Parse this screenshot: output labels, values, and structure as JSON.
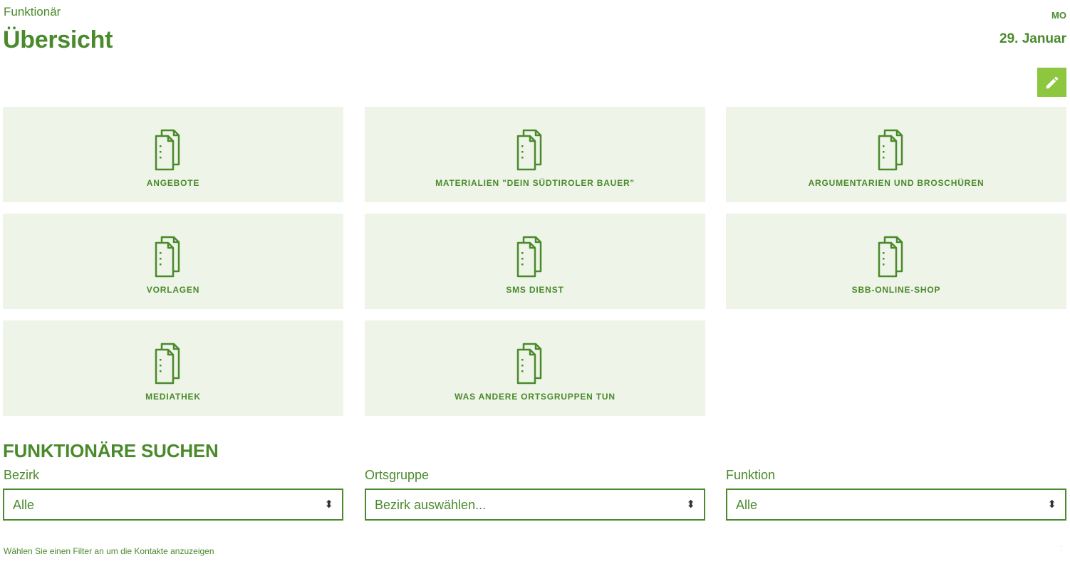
{
  "header": {
    "supertitle": "Funktionär",
    "title": "Übersicht",
    "day": "MO",
    "date": "29. Januar"
  },
  "tiles": [
    {
      "label": "ANGEBOTE",
      "icon": "document-icon"
    },
    {
      "label": "MATERIALIEN \"DEIN SÜDTIROLER BAUER\"",
      "icon": "document-icon"
    },
    {
      "label": "ARGUMENTARIEN UND BROSCHÜREN",
      "icon": "document-icon"
    },
    {
      "label": "VORLAGEN",
      "icon": "document-icon"
    },
    {
      "label": "SMS DIENST",
      "icon": "document-icon"
    },
    {
      "label": "SBB-ONLINE-SHOP",
      "icon": "document-icon"
    },
    {
      "label": "MEDIATHEK",
      "icon": "document-icon"
    },
    {
      "label": "WAS ANDERE ORTSGRUPPEN TUN",
      "icon": "document-icon"
    }
  ],
  "search": {
    "title": "FUNKTIONÄRE SUCHEN",
    "filters": [
      {
        "label": "Bezirk",
        "value": "Alle"
      },
      {
        "label": "Ortsgruppe",
        "value": "Bezirk auswählen..."
      },
      {
        "label": "Funktion",
        "value": "Alle"
      }
    ],
    "hint": "Wählen Sie einen Filter an um die Kontakte anzuzeigen"
  },
  "colors": {
    "primary": "#4a8a2c",
    "tile_bg": "#eef4e8",
    "edit_button": "#8dc63f"
  },
  "icons": {
    "edit": "pencil-icon",
    "tile": "document-icon",
    "select": "sort-arrows-icon"
  }
}
